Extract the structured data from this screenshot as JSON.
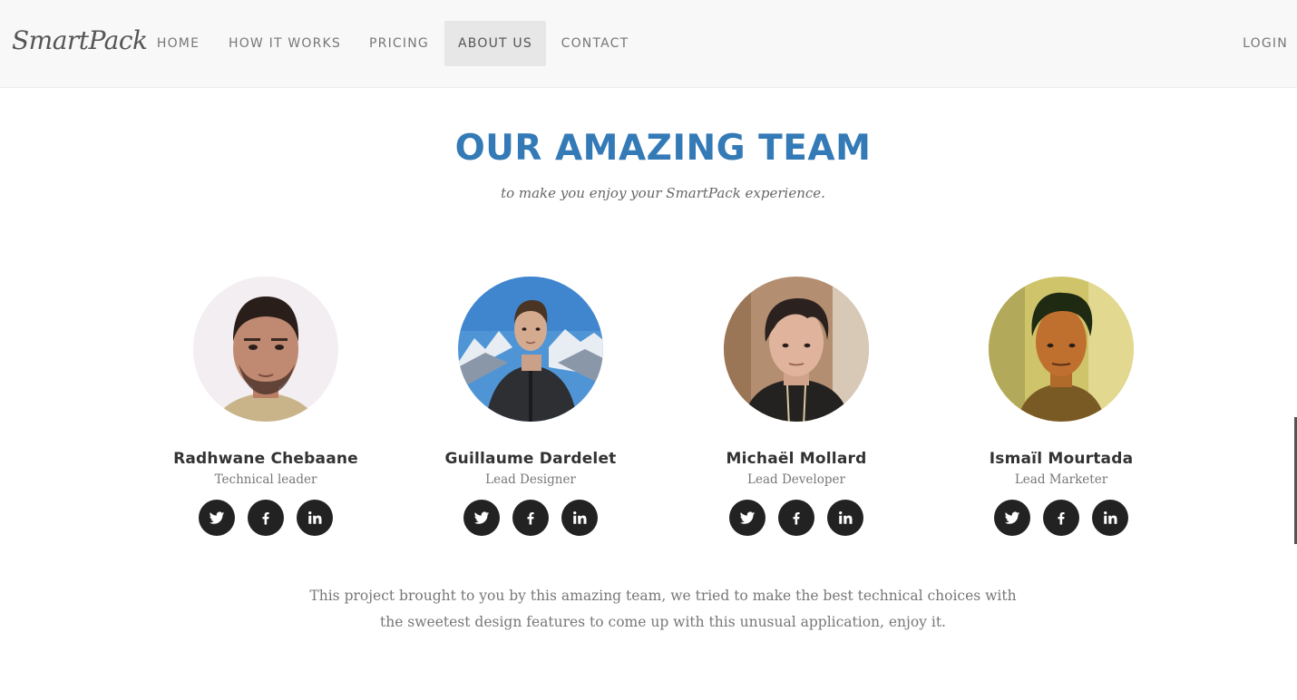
{
  "navbar": {
    "brand": "SmartPack",
    "items": [
      {
        "label": "HOME",
        "active": false
      },
      {
        "label": "HOW IT WORKS",
        "active": false
      },
      {
        "label": "PRICING",
        "active": false
      },
      {
        "label": "ABOUT US",
        "active": true
      },
      {
        "label": "CONTACT",
        "active": false
      }
    ],
    "login": "LOGIN"
  },
  "team": {
    "title": "OUR AMAZING TEAM",
    "subtitle": "to make you enjoy your SmartPack experience.",
    "members": [
      {
        "name": "Radhwane Chebaane",
        "role": "Technical leader"
      },
      {
        "name": "Guillaume Dardelet",
        "role": "Lead Designer"
      },
      {
        "name": "Michaël Mollard",
        "role": "Lead Developer"
      },
      {
        "name": "Ismaïl Mourtada",
        "role": "Lead Marketer"
      }
    ],
    "social_icons": [
      "twitter-icon",
      "facebook-icon",
      "linkedin-icon"
    ],
    "outro": "This project brought to you by this amazing team, we tried to make the best technical choices with the sweetest design features to come up with this unusual application, enjoy it."
  },
  "colors": {
    "accent": "#337ab7",
    "navbar_bg": "#f8f8f8",
    "active_nav_bg": "#e7e7e7",
    "social_bg": "#222222"
  }
}
